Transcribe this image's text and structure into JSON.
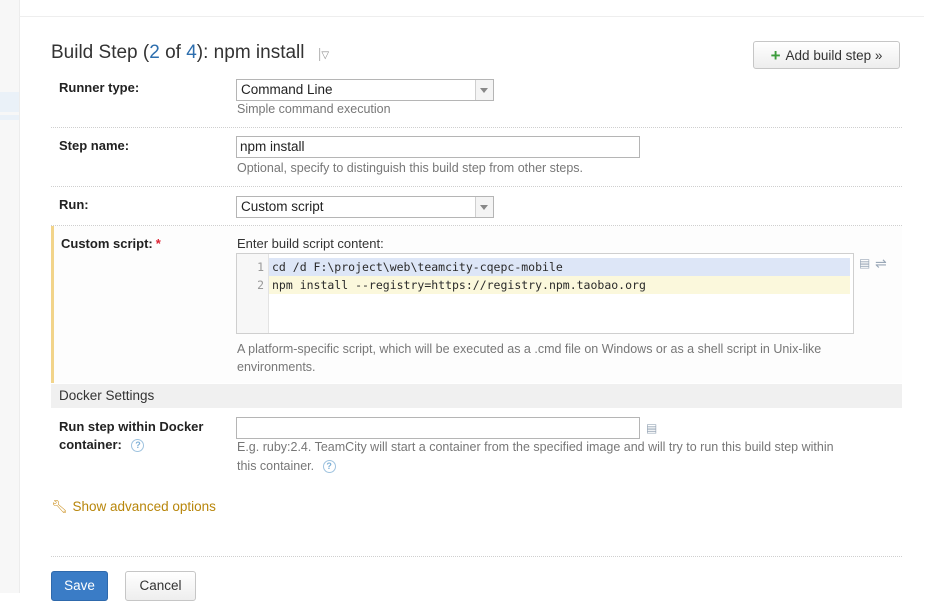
{
  "header": {
    "title_prefix": "Build Step (",
    "step_current": "2",
    "step_of": " of ",
    "step_total": "4",
    "title_suffix": "): npm install",
    "add_build_step_label": "Add build step »"
  },
  "form": {
    "runner_type": {
      "label": "Runner type:",
      "value": "Command Line",
      "hint": "Simple command execution"
    },
    "step_name": {
      "label": "Step name:",
      "value": "npm install",
      "hint": "Optional, specify to distinguish this build step from other steps."
    },
    "run": {
      "label": "Run:",
      "value": "Custom script"
    },
    "custom_script": {
      "label": "Custom script:",
      "required_mark": "*",
      "editor_caption": "Enter build script content:",
      "lines": [
        {
          "num": "1",
          "text": "cd /d F:\\project\\web\\teamcity-cqepc-mobile"
        },
        {
          "num": "2",
          "text": "npm install --registry=https://registry.npm.taobao.org"
        }
      ],
      "hint_line1": "A platform-specific script, which will be executed as a .cmd file on Windows or as a shell script in Unix-like",
      "hint_line2": "environments."
    },
    "docker": {
      "section_title": "Docker Settings",
      "label_line1": "Run step within Docker",
      "label_line2": "container:",
      "value": "",
      "hint_line1": "E.g. ruby:2.4. TeamCity will start a container from the specified image and will try to run this build step within",
      "hint_line2": "this container."
    },
    "advanced_label": "Show advanced options"
  },
  "actions": {
    "save_label": "Save",
    "cancel_label": "Cancel"
  },
  "colors": {
    "accent": "#3a7cc6",
    "required_bar": "#f2d48a",
    "add_icon": "#3c9c3c"
  }
}
